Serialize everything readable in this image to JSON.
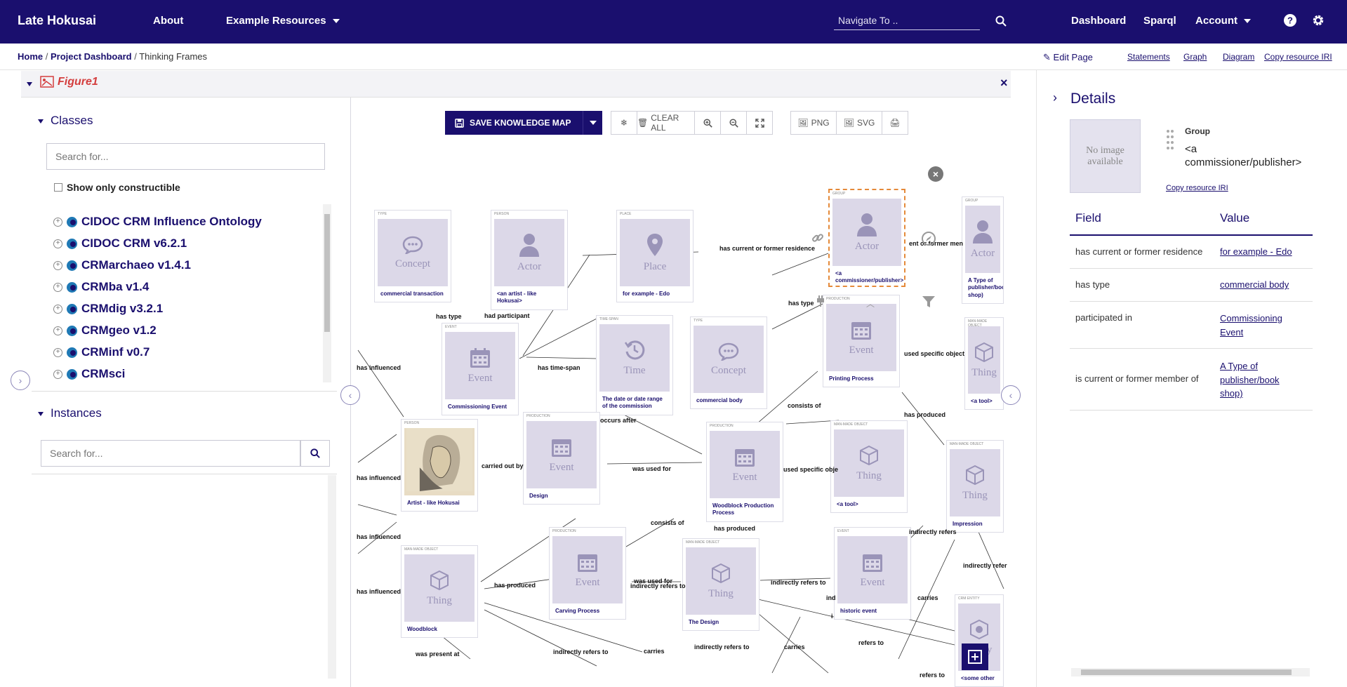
{
  "nav": {
    "brand": "Late Hokusai",
    "about": "About",
    "example_resources": "Example Resources",
    "search_placeholder": "Navigate To ..",
    "dashboard": "Dashboard",
    "sparql": "Sparql",
    "account": "Account"
  },
  "breadcrumb": {
    "home": "Home",
    "project_dashboard": "Project Dashboard",
    "current": "Thinking Frames"
  },
  "page_actions": {
    "edit_page": "Edit Page",
    "statements": "Statements",
    "graph": "Graph",
    "diagram": "Diagram",
    "copy_iri": "Copy resource IRI"
  },
  "figure": {
    "title": "Figure1",
    "close": "×"
  },
  "classes": {
    "title": "Classes",
    "search_placeholder": "Search for...",
    "show_only_constructible": "Show only constructible",
    "items": [
      "CIDOC CRM Influence Ontology",
      "CIDOC CRM v6.2.1",
      "CRMarchaeo v1.4.1",
      "CRMba v1.4",
      "CRMdig v3.2.1",
      "CRMgeo v1.2",
      "CRMinf v0.7",
      "CRMsci"
    ]
  },
  "instances": {
    "title": "Instances",
    "search_placeholder": "Search for..."
  },
  "toolbar": {
    "save": "SAVE KNOWLEDGE MAP",
    "clear_all": "CLEAR ALL",
    "png": "PNG",
    "svg": "SVG"
  },
  "nodes": [
    {
      "type": "TYPE",
      "kind": "Concept",
      "label": "commercial transaction"
    },
    {
      "type": "PERSON",
      "kind": "Actor",
      "label": "<an artist - like Hokusai>"
    },
    {
      "type": "PLACE",
      "kind": "Place",
      "label": "for example - Edo"
    },
    {
      "type": "GROUP",
      "kind": "Actor",
      "label": "<a commissioner/publisher>"
    },
    {
      "type": "GROUP",
      "kind": "Actor",
      "label": "A Type of publisher/book shop)"
    },
    {
      "type": "EVENT",
      "kind": "Event",
      "label": "Commissioning Event"
    },
    {
      "type": "TIME-SPAN",
      "kind": "Time",
      "label": "The date or date range of the commission"
    },
    {
      "type": "TYPE",
      "kind": "Concept",
      "label": "commercial body"
    },
    {
      "type": "PRODUCTION",
      "kind": "Event",
      "label": "Printing Process"
    },
    {
      "type": "MAN-MADE OBJECT",
      "kind": "Thing",
      "label": "<a tool>"
    },
    {
      "type": "PERSON",
      "kind": "",
      "label": "Artist - like Hokusai"
    },
    {
      "type": "PRODUCTION",
      "kind": "Event",
      "label": "Design"
    },
    {
      "type": "PRODUCTION",
      "kind": "Event",
      "label": "Woodblock Production Process"
    },
    {
      "type": "MAN-MADE OBJECT",
      "kind": "Thing",
      "label": "<a tool>"
    },
    {
      "type": "MAN-MADE OBJECT",
      "kind": "Thing",
      "label": "Impression"
    },
    {
      "type": "MAN-MADE OBJECT",
      "kind": "Thing",
      "label": "Woodblock"
    },
    {
      "type": "PRODUCTION",
      "kind": "Event",
      "label": "Carving Process"
    },
    {
      "type": "MAN-MADE OBJECT",
      "kind": "Thing",
      "label": "The Design"
    },
    {
      "type": "EVENT",
      "kind": "Event",
      "label": "historic event"
    },
    {
      "type": "CRM ENTITY",
      "kind": "Entity",
      "label": "<some other"
    }
  ],
  "edges": [
    "has current or former residence",
    "ent or former men",
    "has type",
    "had participant",
    "has type",
    "has time-span",
    "used specific object",
    "has influenced",
    "consists of",
    "occurs after",
    "has produced",
    "carried out by",
    "was used for",
    "used specific obje",
    "has influenced",
    "has influenced",
    "consists of",
    "has produced",
    "indirectly refers",
    "indirectly refer",
    "has influenced",
    "has produced",
    "was used for",
    "indirectly refers to",
    "indirectly refers to",
    "carries",
    "was present at",
    "indirectly refers to",
    "carries",
    "indirectly refers to",
    "carries",
    "refers to",
    "refers to",
    "ind",
    "i"
  ],
  "details": {
    "title": "Details",
    "no_image": "No image available",
    "group_type": "Group",
    "group_name": "<a commissioner/publisher>",
    "copy_iri": "Copy resource IRI",
    "field_header": "Field",
    "value_header": "Value",
    "rows": [
      {
        "field": "has current or former residence",
        "value": "for example - Edo"
      },
      {
        "field": "has type",
        "value": "commercial body"
      },
      {
        "field": "participated in",
        "value": "Commissioning Event"
      },
      {
        "field": "is current or former member of",
        "value": "A Type of publisher/book shop)"
      }
    ]
  },
  "colors": {
    "navbar": "#1a0f6e",
    "accent_red": "#d43e3e",
    "node_fill": "#dcd8e8",
    "selection_orange": "#e58a3a"
  }
}
